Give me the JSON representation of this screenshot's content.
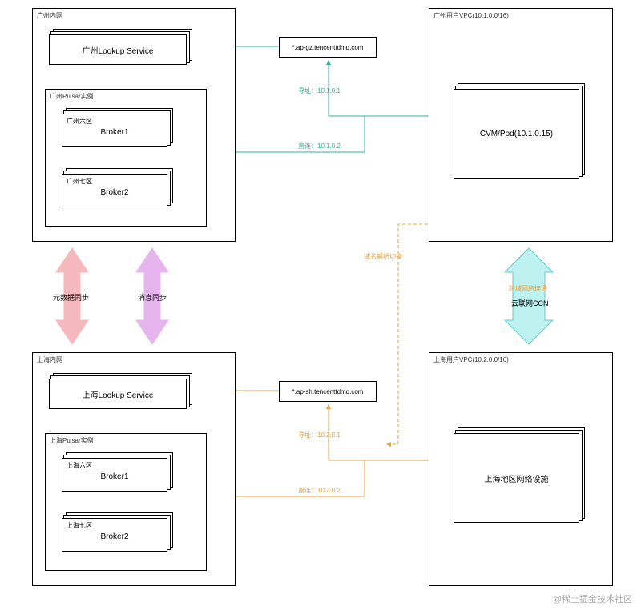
{
  "gz": {
    "intranet_label": "广州内网",
    "lookup": "广州Lookup Service",
    "pulsar_label": "广州Pulsar实例",
    "zone1_label": "广州六区",
    "broker1": "Broker1",
    "zone2_label": "广州七区",
    "broker2": "Broker2",
    "domain": "*.ap-gz.tencenttdmq.com",
    "vpc_label": "广州用户VPC(10.1.0.0/16)",
    "cvm": "CVM/Pod(10.1.0.15)",
    "lookup_addr": "寻址：10.1.0.1",
    "direct_addr": "直连：10.1.0.2"
  },
  "center": {
    "meta_sync": "元数据同步",
    "msg_sync": "消息同步",
    "dns_switch": "域名解析切换",
    "cross_region": "跨域网络连通",
    "ccn": "云联网CCN"
  },
  "sh": {
    "intranet_label": "上海内网",
    "lookup": "上海Lookup Service",
    "pulsar_label": "上海Pulsar实例",
    "zone1_label": "上海六区",
    "broker1": "Broker1",
    "zone2_label": "上海七区",
    "broker2": "Broker2",
    "domain": "*.ap-sh.tencenttdmq.com",
    "vpc_label": "上海用户VPC(10.2.0.0/16)",
    "facility": "上海地区网络设施",
    "lookup_addr": "寻址：10.2.0.1",
    "direct_addr": "直连：10.2.0.2"
  },
  "watermark": "@稀土掘金技术社区"
}
